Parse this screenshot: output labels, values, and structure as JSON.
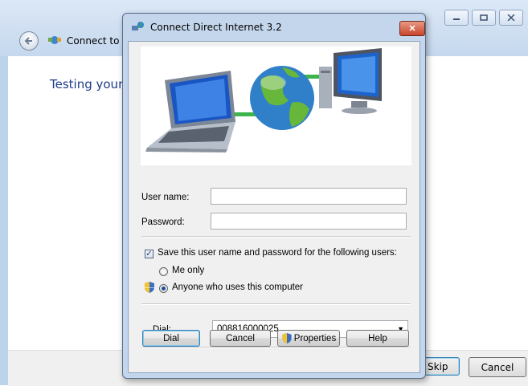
{
  "background_window": {
    "title": "Connect to t",
    "heading": "Testing your",
    "window_controls": [
      "minimize-icon",
      "maximize-icon",
      "close-icon"
    ],
    "buttons": {
      "skip": "Skip",
      "cancel": "Cancel"
    }
  },
  "dialog": {
    "title": "Connect Direct Internet 3.2",
    "close_symbol": "✕",
    "username_label": "User name:",
    "username_value": "",
    "password_label": "Password:",
    "password_value": "",
    "save_checkbox": {
      "label": "Save this user name and password for the following users:",
      "checked": true
    },
    "radio_me_only": {
      "label": "Me only",
      "selected": false
    },
    "radio_anyone": {
      "label": "Anyone who uses this computer",
      "selected": true
    },
    "dial_label": "Dial:",
    "dial_value": "008816000025",
    "buttons": {
      "dial": "Dial",
      "cancel": "Cancel",
      "properties": "Properties",
      "help": "Help"
    }
  },
  "colors": {
    "accent": "#1e3b8a",
    "frame": "#c4d6ec",
    "globe": "#2f7fc9",
    "link_line": "#3cb54a"
  }
}
